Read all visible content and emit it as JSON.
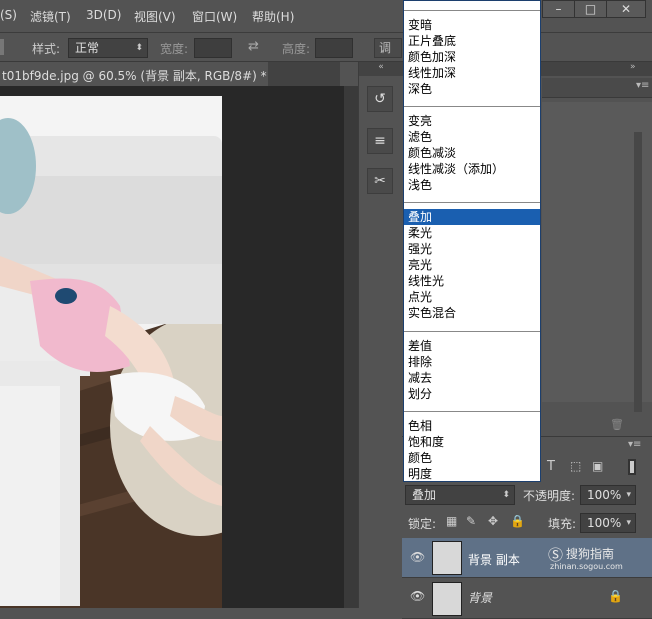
{
  "menubar": {
    "items": [
      "(S)",
      "滤镜(T)",
      "3D(D)",
      "视图(V)",
      "窗口(W)",
      "帮助(H)"
    ],
    "minimize": "–",
    "restore": "□",
    "close": "✕"
  },
  "options": {
    "style_label": "样式:",
    "style_value": "正常",
    "width_label": "宽度:",
    "height_label": "高度:",
    "adjust_label": "调"
  },
  "document": {
    "tab_title": "t01bf9de.jpg @ 60.5% (背景 副本, RGB/8#) *"
  },
  "blend_modes": {
    "groups": [
      [
        "变暗",
        "正片叠底",
        "颜色加深",
        "线性加深",
        "深色"
      ],
      [
        "变亮",
        "滤色",
        "颜色减淡",
        "线性减淡（添加）",
        "浅色"
      ],
      [
        "叠加",
        "柔光",
        "强光",
        "亮光",
        "线性光",
        "点光",
        "实色混合"
      ],
      [
        "差值",
        "排除",
        "减去",
        "划分"
      ],
      [
        "色相",
        "饱和度",
        "颜色",
        "明度"
      ]
    ],
    "selected": "叠加"
  },
  "layers": {
    "blend_value": "叠加",
    "opacity_label": "不透明度:",
    "opacity_value": "100%",
    "lock_label": "锁定:",
    "fill_label": "填充:",
    "fill_value": "100%",
    "rows": [
      {
        "name": "背景 副本"
      },
      {
        "name": "背景"
      }
    ]
  },
  "watermark": {
    "brand": "搜狗指南",
    "url": "zhinan.sogou.com"
  },
  "colors": {
    "highlight": "#1a5fb0",
    "panel": "#535353"
  }
}
